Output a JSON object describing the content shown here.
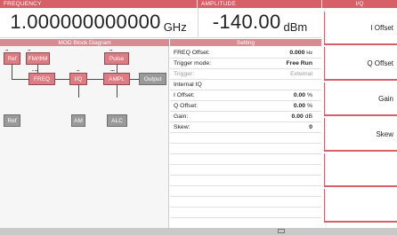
{
  "frequency": {
    "header": "FREQUENCY",
    "value": "1.000000000000",
    "unit": "GHz"
  },
  "amplitude": {
    "header": "AMPLITUDE",
    "value": "-140.00",
    "unit": "dBm"
  },
  "side_panel": {
    "header": "I/Q",
    "buttons": [
      {
        "label": "I Offset"
      },
      {
        "label": "Q Offset"
      },
      {
        "label": "Gain"
      },
      {
        "label": "Skew"
      },
      {
        "label": ""
      },
      {
        "label": ""
      }
    ]
  },
  "block_diagram": {
    "title": "MOD Block Diagram",
    "blocks": {
      "ref": "Ref",
      "fmpm": "FM/ΦM",
      "pulse": "Pulse",
      "freq": "FREQ",
      "iq": "I/Q",
      "ampl": "AMPL",
      "output": "Output",
      "ref2": "Ref",
      "am": "AM",
      "alc": "ALC"
    }
  },
  "settings": {
    "title": "Setting",
    "rows": [
      {
        "label": "FREQ Offset:",
        "value": "0.000",
        "unit": "Hz"
      },
      {
        "label": "Trigger mode:",
        "value": "Free Run",
        "unit": ""
      },
      {
        "label": "Trigger:",
        "value": "External",
        "unit": ""
      },
      {
        "label": "Internal IQ",
        "value": "",
        "unit": ""
      },
      {
        "label": "I Offset:",
        "value": "0.00",
        "unit": "%"
      },
      {
        "label": "Q Offset:",
        "value": "0.00",
        "unit": "%"
      },
      {
        "label": "Gain:",
        "value": "0.00",
        "unit": "dB"
      },
      {
        "label": "Skew:",
        "value": "0",
        "unit": ""
      }
    ]
  },
  "colors": {
    "accent": "#d75f68",
    "accent_light": "#d98b92",
    "block_red": "#dd7d83",
    "block_grey": "#9a9a9a"
  }
}
